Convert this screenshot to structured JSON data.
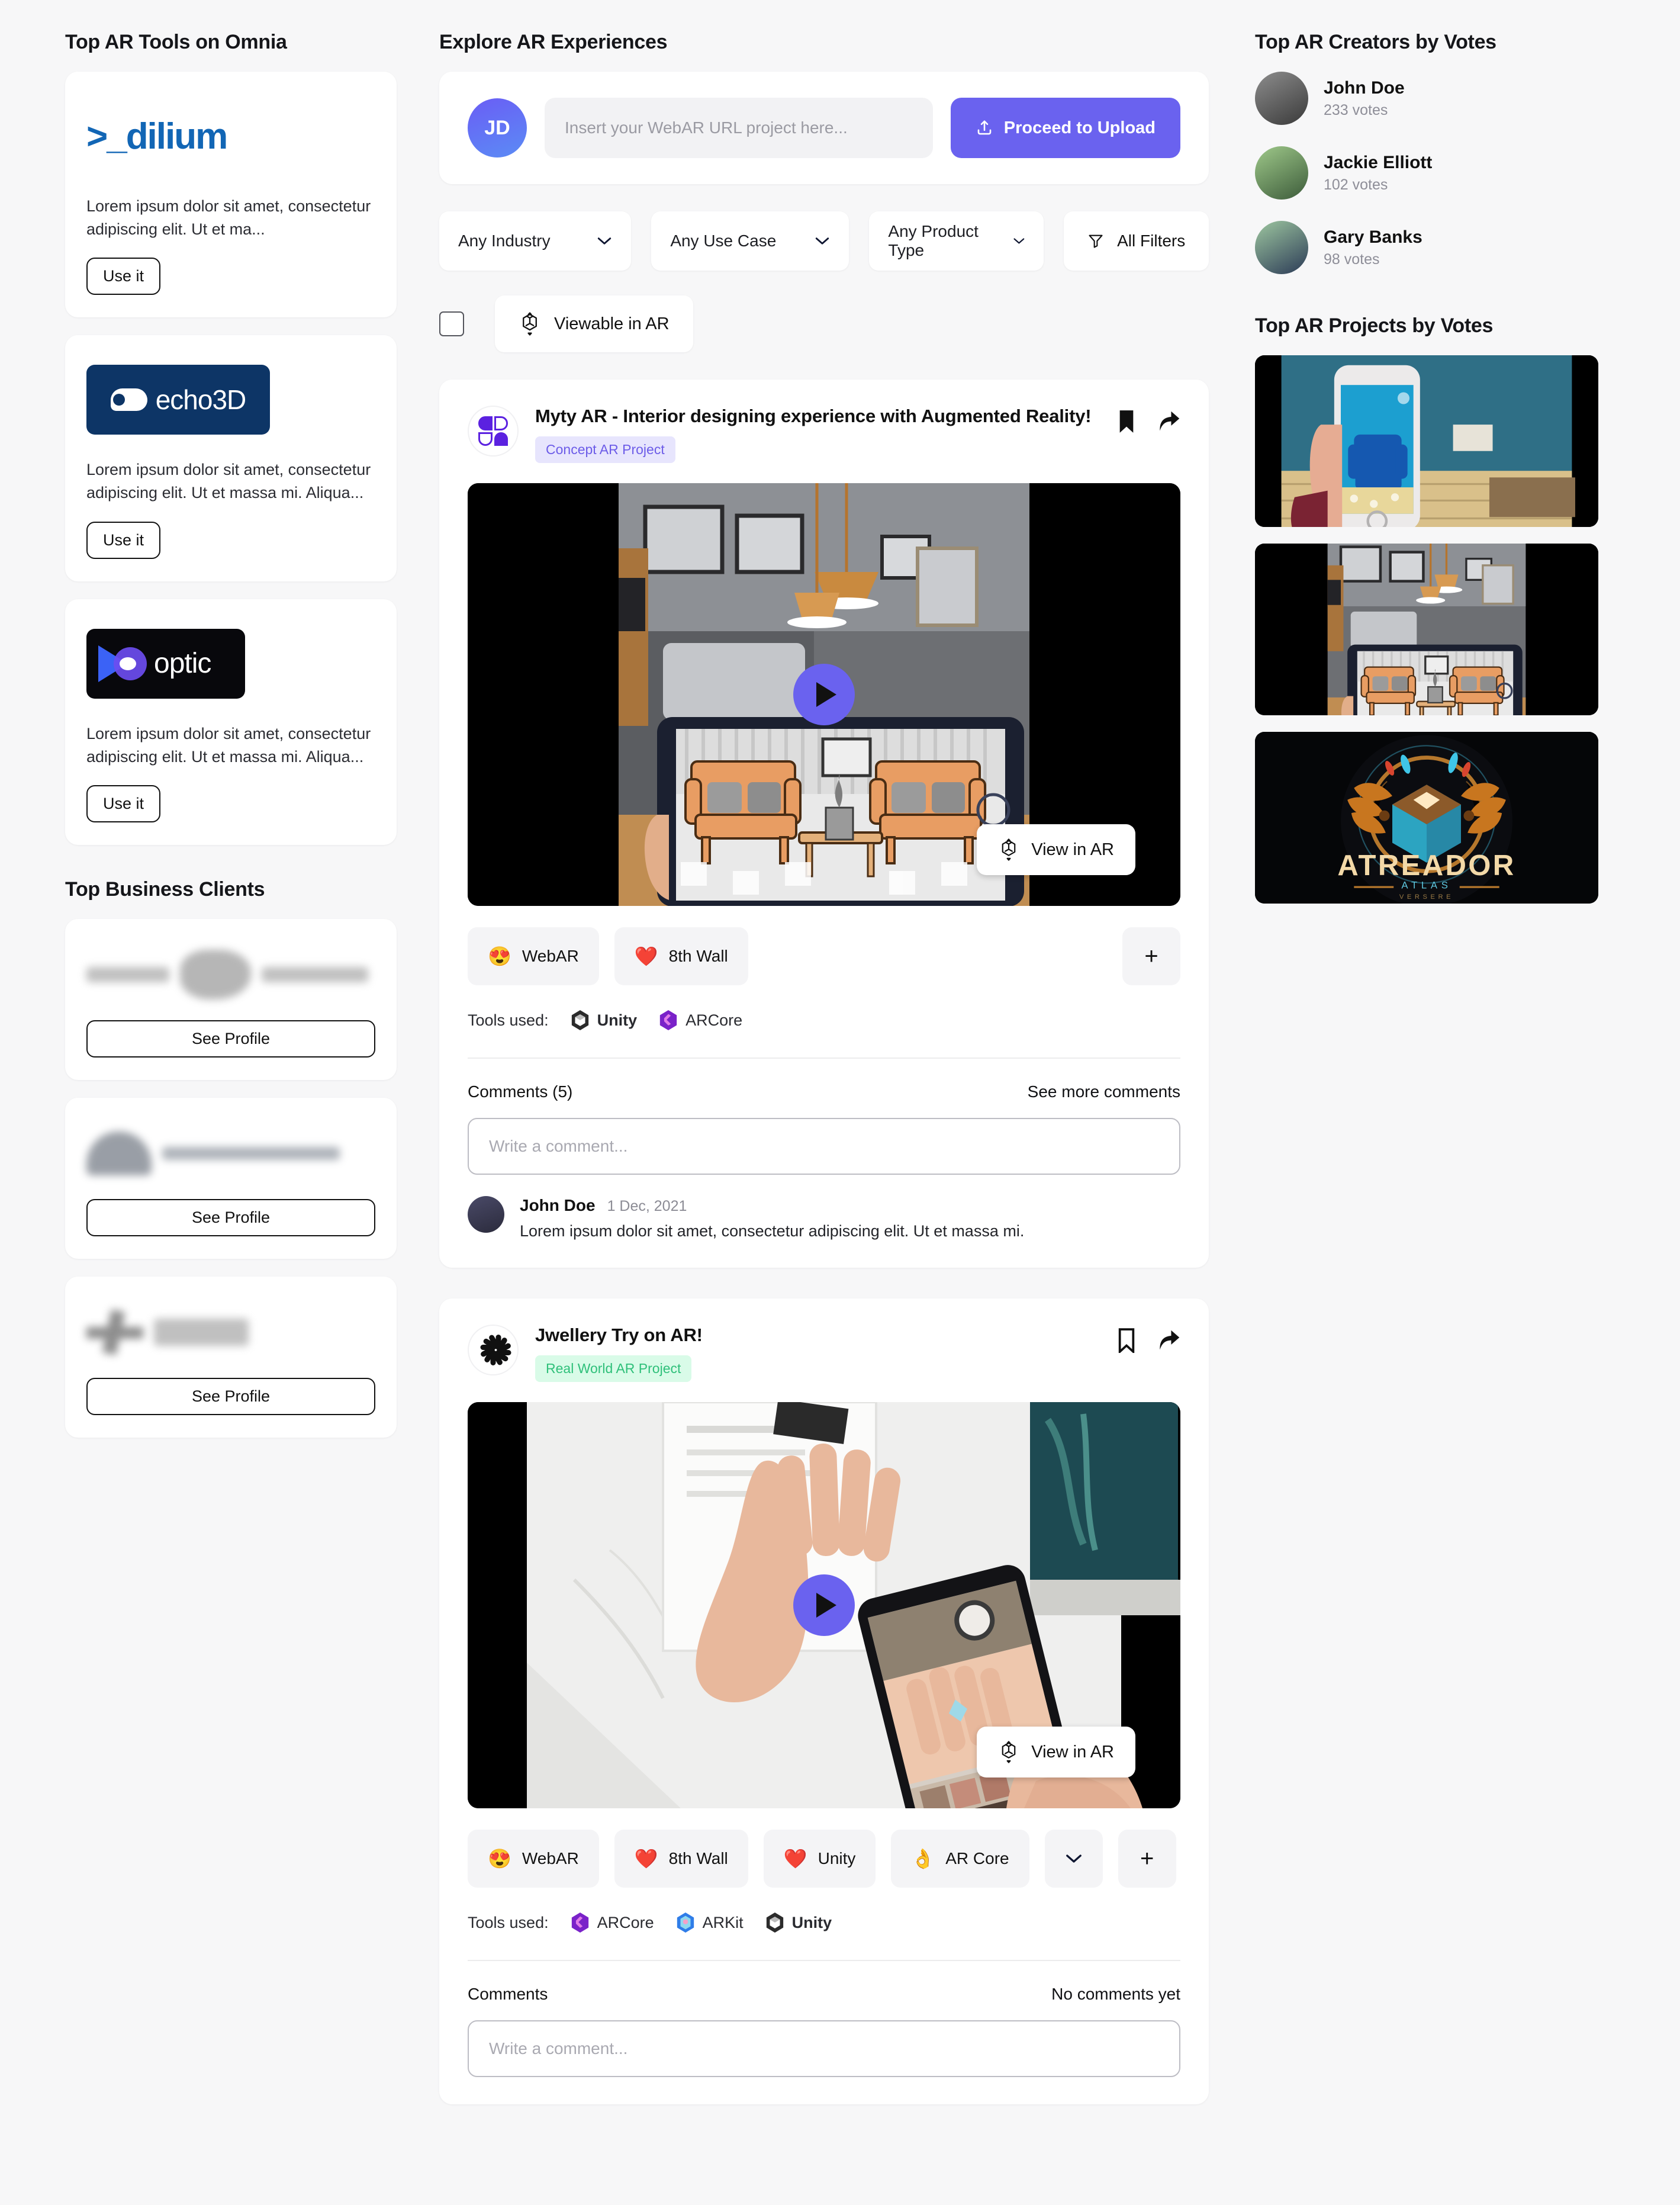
{
  "left": {
    "tools_title": "Top AR Tools on Omnia",
    "tools": [
      {
        "logo_text": ">_dilium",
        "desc": "Lorem ipsum dolor sit amet, consectetur adipiscing elit. Ut et ma...",
        "cta": "Use it"
      },
      {
        "logo_text": "echo3D",
        "desc": "Lorem ipsum dolor sit amet, consectetur adipiscing elit. Ut et massa mi. Aliqua...",
        "cta": "Use it"
      },
      {
        "logo_text": "optic",
        "desc": "Lorem ipsum dolor sit amet, consectetur adipiscing elit. Ut et massa mi. Aliqua...",
        "cta": "Use it"
      }
    ],
    "clients_title": "Top Business Clients",
    "clients": [
      {
        "cta": "See Profile"
      },
      {
        "cta": "See Profile"
      },
      {
        "cta": "See Profile"
      }
    ]
  },
  "center": {
    "title": "Explore AR Experiences",
    "upload": {
      "avatar_initials": "JD",
      "input_placeholder": "Insert your WebAR URL project here...",
      "button_label": "Proceed to Upload"
    },
    "filters": {
      "industry": "Any Industry",
      "use_case": "Any Use Case",
      "product_type": "Any Product Type",
      "all_filters": "All Filters",
      "viewable_in_ar": "Viewable in AR",
      "viewable_checked": false
    },
    "posts": [
      {
        "title": "Myty AR - Interior designing experience with Augmented Reality!",
        "badge": "Concept AR Project",
        "badge_kind": "concept",
        "view_ar_label": "View in AR",
        "reactions": [
          {
            "emoji": "😍",
            "label": "WebAR"
          },
          {
            "emoji": "❤️",
            "label": "8th Wall"
          }
        ],
        "has_more_reactions": false,
        "add_reaction_label": "+",
        "tools_label": "Tools used:",
        "tools": [
          "Unity",
          "ARCore"
        ],
        "comments_label": "Comments (5)",
        "comments_action": "See more comments",
        "comment_placeholder": "Write a comment...",
        "comments": [
          {
            "author": "John Doe",
            "date": "1 Dec, 2021",
            "text": "Lorem ipsum dolor sit amet, consectetur adipiscing elit. Ut et massa mi."
          }
        ]
      },
      {
        "title": "Jwellery Try on AR!",
        "badge": "Real World AR Project",
        "badge_kind": "real",
        "view_ar_label": "View in AR",
        "reactions": [
          {
            "emoji": "😍",
            "label": "WebAR"
          },
          {
            "emoji": "❤️",
            "label": "8th Wall"
          },
          {
            "emoji": "❤️",
            "label": "Unity"
          },
          {
            "emoji": "👌",
            "label": "AR Core"
          }
        ],
        "has_more_reactions": true,
        "add_reaction_label": "+",
        "tools_label": "Tools used:",
        "tools": [
          "ARCore",
          "ARKit",
          "Unity"
        ],
        "comments_label": "Comments",
        "comments_action": "No comments yet",
        "comment_placeholder": "Write a comment...",
        "comments": []
      }
    ]
  },
  "right": {
    "creators_title": "Top AR Creators by Votes",
    "creators": [
      {
        "name": "John Doe",
        "votes": "233 votes"
      },
      {
        "name": "Jackie Elliott",
        "votes": "102 votes"
      },
      {
        "name": "Gary Banks",
        "votes": "98 votes"
      }
    ],
    "projects_title": "Top AR Projects by Votes",
    "projects": [
      {
        "alt": "Hand holding phone with blue armchair in AR"
      },
      {
        "alt": "Hand holding tablet showing orange sofas in AR"
      },
      {
        "alt": "ATREADOR ATLAS emblem artwork"
      }
    ]
  },
  "colors": {
    "accent": "#6a62ef",
    "badge_concept_bg": "#e7e5fd",
    "badge_concept_fg": "#6c5ce8",
    "badge_real_bg": "#d9fbe8",
    "badge_real_fg": "#2fc07a",
    "page_bg": "#f7f7f8"
  }
}
